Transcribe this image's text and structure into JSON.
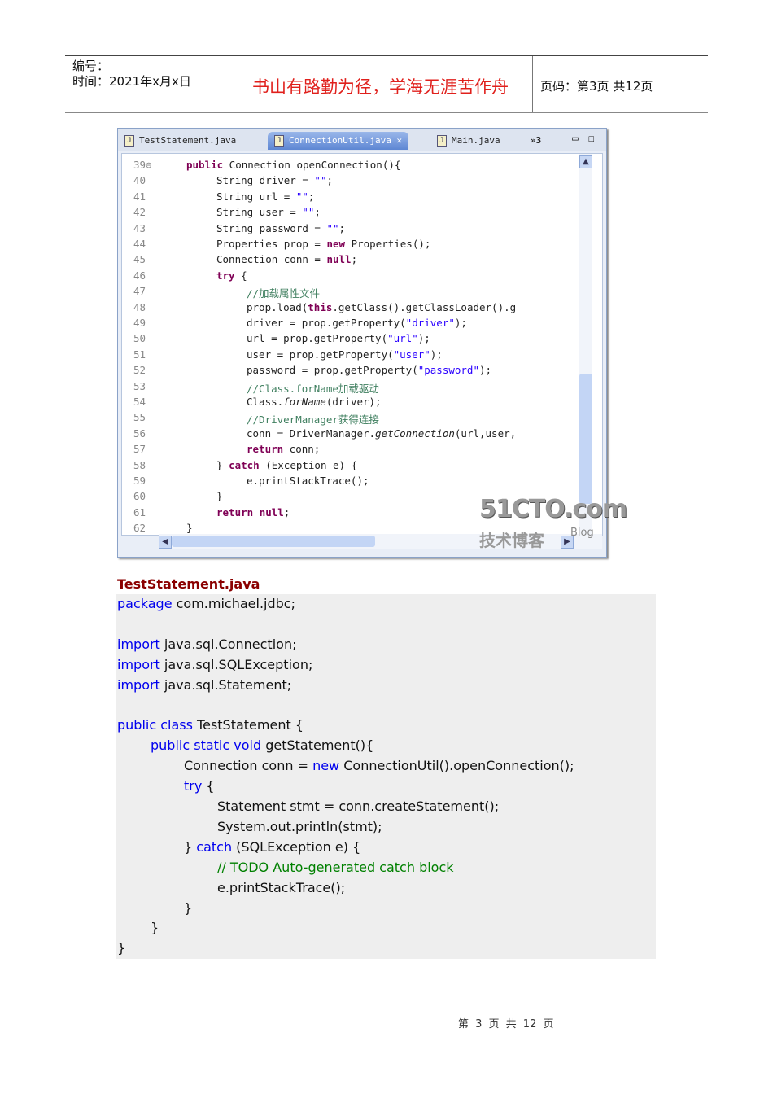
{
  "header": {
    "id_label": "编号：",
    "time_label": "时间：2021年x月x日",
    "motto": "书山有路勤为径，学海无涯苦作舟",
    "page_label": "页码：第3页 共12页"
  },
  "ide": {
    "tabs": [
      {
        "label": "TestStatement.java"
      },
      {
        "label": "ConnectionUtil.java",
        "close": "✕"
      },
      {
        "label": "Main.java"
      }
    ],
    "overflow": "»3",
    "watermark": {
      "brand": "51CTO.com",
      "sub": "技术博客",
      "blog": "Blog"
    },
    "lines": [
      {
        "n": "39⊖",
        "i": 1,
        "s": [
          [
            "public",
            "kw"
          ],
          [
            " Connection openConnection(){",
            ""
          ]
        ]
      },
      {
        "n": "40",
        "i": 2,
        "s": [
          [
            "String driver = ",
            ""
          ],
          [
            "\"\"",
            "str"
          ],
          [
            ";",
            ""
          ]
        ]
      },
      {
        "n": "41",
        "i": 2,
        "s": [
          [
            "String url = ",
            ""
          ],
          [
            "\"\"",
            "str"
          ],
          [
            ";",
            ""
          ]
        ]
      },
      {
        "n": "42",
        "i": 2,
        "s": [
          [
            "String user = ",
            ""
          ],
          [
            "\"\"",
            "str"
          ],
          [
            ";",
            ""
          ]
        ]
      },
      {
        "n": "43",
        "i": 2,
        "s": [
          [
            "String password = ",
            ""
          ],
          [
            "\"\"",
            "str"
          ],
          [
            ";",
            ""
          ]
        ]
      },
      {
        "n": "44",
        "i": 2,
        "s": [
          [
            "Properties prop = ",
            ""
          ],
          [
            "new",
            "kw"
          ],
          [
            " Properties();",
            ""
          ]
        ]
      },
      {
        "n": "45",
        "i": 2,
        "s": [
          [
            "Connection conn = ",
            ""
          ],
          [
            "null",
            "kw"
          ],
          [
            ";",
            ""
          ]
        ]
      },
      {
        "n": "46",
        "i": 2,
        "s": [
          [
            "try",
            "kw"
          ],
          [
            " {",
            ""
          ]
        ]
      },
      {
        "n": "47",
        "i": 3,
        "s": [
          [
            "//加载属性文件",
            "cm"
          ]
        ]
      },
      {
        "n": "48",
        "i": 3,
        "s": [
          [
            "prop.load(",
            ""
          ],
          [
            "this",
            "kw"
          ],
          [
            ".getClass().getClassLoader().g",
            ""
          ]
        ]
      },
      {
        "n": "49",
        "i": 3,
        "s": [
          [
            "driver = prop.getProperty(",
            ""
          ],
          [
            "\"driver\"",
            "str"
          ],
          [
            ");",
            ""
          ]
        ]
      },
      {
        "n": "50",
        "i": 3,
        "s": [
          [
            "url = prop.getProperty(",
            ""
          ],
          [
            "\"url\"",
            "str"
          ],
          [
            ");",
            ""
          ]
        ]
      },
      {
        "n": "51",
        "i": 3,
        "s": [
          [
            "user = prop.getProperty(",
            ""
          ],
          [
            "\"user\"",
            "str"
          ],
          [
            ");",
            ""
          ]
        ]
      },
      {
        "n": "52",
        "i": 3,
        "s": [
          [
            "password = prop.getProperty(",
            ""
          ],
          [
            "\"password\"",
            "str"
          ],
          [
            ");",
            ""
          ]
        ]
      },
      {
        "n": "53",
        "i": 3,
        "s": [
          [
            "//Class.forName加载驱动",
            "cm"
          ]
        ]
      },
      {
        "n": "54",
        "i": 3,
        "s": [
          [
            "Class.",
            ""
          ],
          [
            "forName",
            "it"
          ],
          [
            "(driver);",
            ""
          ]
        ]
      },
      {
        "n": "55",
        "i": 3,
        "s": [
          [
            "//DriverManager获得连接",
            "cm"
          ]
        ]
      },
      {
        "n": "56",
        "i": 3,
        "s": [
          [
            "conn = DriverManager.",
            ""
          ],
          [
            "getConnection",
            "it"
          ],
          [
            "(url,user,",
            ""
          ]
        ]
      },
      {
        "n": "57",
        "i": 3,
        "s": [
          [
            "return",
            "kw"
          ],
          [
            " conn;",
            ""
          ]
        ]
      },
      {
        "n": "58",
        "i": 2,
        "s": [
          [
            "} ",
            ""
          ],
          [
            "catch",
            "kw"
          ],
          [
            " (Exception e) {",
            ""
          ]
        ]
      },
      {
        "n": "59",
        "i": 3,
        "s": [
          [
            "e.printStackTrace();",
            ""
          ]
        ]
      },
      {
        "n": "60",
        "i": 2,
        "s": [
          [
            "}",
            ""
          ]
        ]
      },
      {
        "n": "61",
        "i": 2,
        "s": [
          [
            "return",
            "kw"
          ],
          [
            " ",
            ""
          ],
          [
            "null",
            "kw"
          ],
          [
            ";",
            ""
          ]
        ]
      },
      {
        "n": "62",
        "i": 1,
        "s": [
          [
            "}",
            ""
          ]
        ]
      }
    ]
  },
  "listing": {
    "title": "TestStatement.java",
    "lines": [
      {
        "i": 0,
        "s": [
          [
            "package",
            "b"
          ],
          [
            " com.michael.jdbc;",
            ""
          ]
        ]
      },
      {
        "i": 0,
        "s": []
      },
      {
        "i": 0,
        "s": [
          [
            "import",
            "b"
          ],
          [
            " java.sql.Connection;",
            ""
          ]
        ]
      },
      {
        "i": 0,
        "s": [
          [
            "import",
            "b"
          ],
          [
            " java.sql.SQLException;",
            ""
          ]
        ]
      },
      {
        "i": 0,
        "s": [
          [
            "import",
            "b"
          ],
          [
            " java.sql.Statement;",
            ""
          ]
        ]
      },
      {
        "i": 0,
        "s": []
      },
      {
        "i": 0,
        "s": [
          [
            "public class",
            "b"
          ],
          [
            " TestStatement {",
            ""
          ]
        ]
      },
      {
        "i": 1,
        "s": [
          [
            "public static void",
            "b"
          ],
          [
            " getStatement(){",
            ""
          ]
        ]
      },
      {
        "i": 2,
        "s": [
          [
            "Connection conn = ",
            ""
          ],
          [
            "new",
            "b"
          ],
          [
            " ConnectionUtil().openConnection();",
            ""
          ]
        ]
      },
      {
        "i": 2,
        "s": [
          [
            "try",
            "b"
          ],
          [
            " {",
            ""
          ]
        ]
      },
      {
        "i": 3,
        "s": [
          [
            "Statement stmt = conn.createStatement();",
            ""
          ]
        ]
      },
      {
        "i": 3,
        "s": [
          [
            "System.out.println(stmt);",
            ""
          ]
        ]
      },
      {
        "i": 2,
        "s": [
          [
            "} ",
            ""
          ],
          [
            "catch",
            "b"
          ],
          [
            " (SQLException e) {",
            ""
          ]
        ]
      },
      {
        "i": 3,
        "s": [
          [
            "// TODO Auto-generated catch block",
            "g"
          ]
        ]
      },
      {
        "i": 3,
        "s": [
          [
            "e.printStackTrace();",
            ""
          ]
        ]
      },
      {
        "i": 2,
        "s": [
          [
            "}",
            ""
          ]
        ]
      },
      {
        "i": 1,
        "s": [
          [
            "}",
            ""
          ]
        ]
      },
      {
        "i": 0,
        "s": [
          [
            "}",
            ""
          ]
        ]
      }
    ]
  },
  "footer": {
    "page": "第 3 页 共 12 页"
  }
}
